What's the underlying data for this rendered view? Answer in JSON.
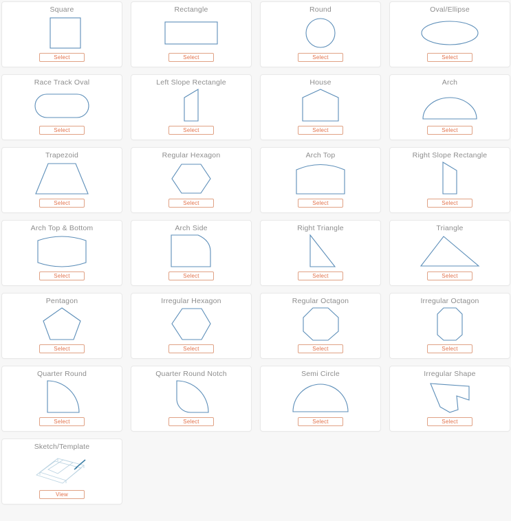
{
  "page": {
    "background_color": "#f7f7f7",
    "card_background": "#ffffff",
    "shape_stroke_color": "#5b8db8",
    "button_border_color": "#e0a184",
    "button_text_color": "#e2714a",
    "title_text_color": "#8d8d8d",
    "columns": 4,
    "card_count": 25
  },
  "cards": [
    {
      "title": "Square",
      "shape": "square-shape",
      "button": "Select"
    },
    {
      "title": "Rectangle",
      "shape": "rectangle-shape",
      "button": "Select"
    },
    {
      "title": "Round",
      "shape": "round-shape",
      "button": "Select"
    },
    {
      "title": "Oval/Ellipse",
      "shape": "oval-ellipse-shape",
      "button": "Select"
    },
    {
      "title": "Race Track Oval",
      "shape": "race-track-oval-shape",
      "button": "Select"
    },
    {
      "title": "Left Slope Rectangle",
      "shape": "left-slope-rectangle-shape",
      "button": "Select"
    },
    {
      "title": "House",
      "shape": "house-shape",
      "button": "Select"
    },
    {
      "title": "Arch",
      "shape": "arch-shape",
      "button": "Select"
    },
    {
      "title": "Trapezoid",
      "shape": "trapezoid-shape",
      "button": "Select"
    },
    {
      "title": "Regular Hexagon",
      "shape": "regular-hexagon-shape",
      "button": "Select"
    },
    {
      "title": "Arch Top",
      "shape": "arch-top-shape",
      "button": "Select"
    },
    {
      "title": "Right Slope Rectangle",
      "shape": "right-slope-rectangle-shape",
      "button": "Select"
    },
    {
      "title": "Arch Top & Bottom",
      "shape": "arch-top-bottom-shape",
      "button": "Select"
    },
    {
      "title": "Arch Side",
      "shape": "arch-side-shape",
      "button": "Select"
    },
    {
      "title": "Right Triangle",
      "shape": "right-triangle-shape",
      "button": "Select"
    },
    {
      "title": "Triangle",
      "shape": "triangle-shape",
      "button": "Select"
    },
    {
      "title": "Pentagon",
      "shape": "pentagon-shape",
      "button": "Select"
    },
    {
      "title": "Irregular Hexagon",
      "shape": "irregular-hexagon-shape",
      "button": "Select"
    },
    {
      "title": "Regular Octagon",
      "shape": "regular-octagon-shape",
      "button": "Select"
    },
    {
      "title": "Irregular Octagon",
      "shape": "irregular-octagon-shape",
      "button": "Select"
    },
    {
      "title": "Quarter Round",
      "shape": "quarter-round-shape",
      "button": "Select"
    },
    {
      "title": "Quarter Round Notch",
      "shape": "quarter-round-notch-shape",
      "button": "Select"
    },
    {
      "title": "Semi Circle",
      "shape": "semi-circle-shape",
      "button": "Select"
    },
    {
      "title": "Irregular Shape",
      "shape": "irregular-shape",
      "button": "Select"
    },
    {
      "title": "Sketch/Template",
      "shape": "sketch-template-icon",
      "button": "View"
    }
  ]
}
